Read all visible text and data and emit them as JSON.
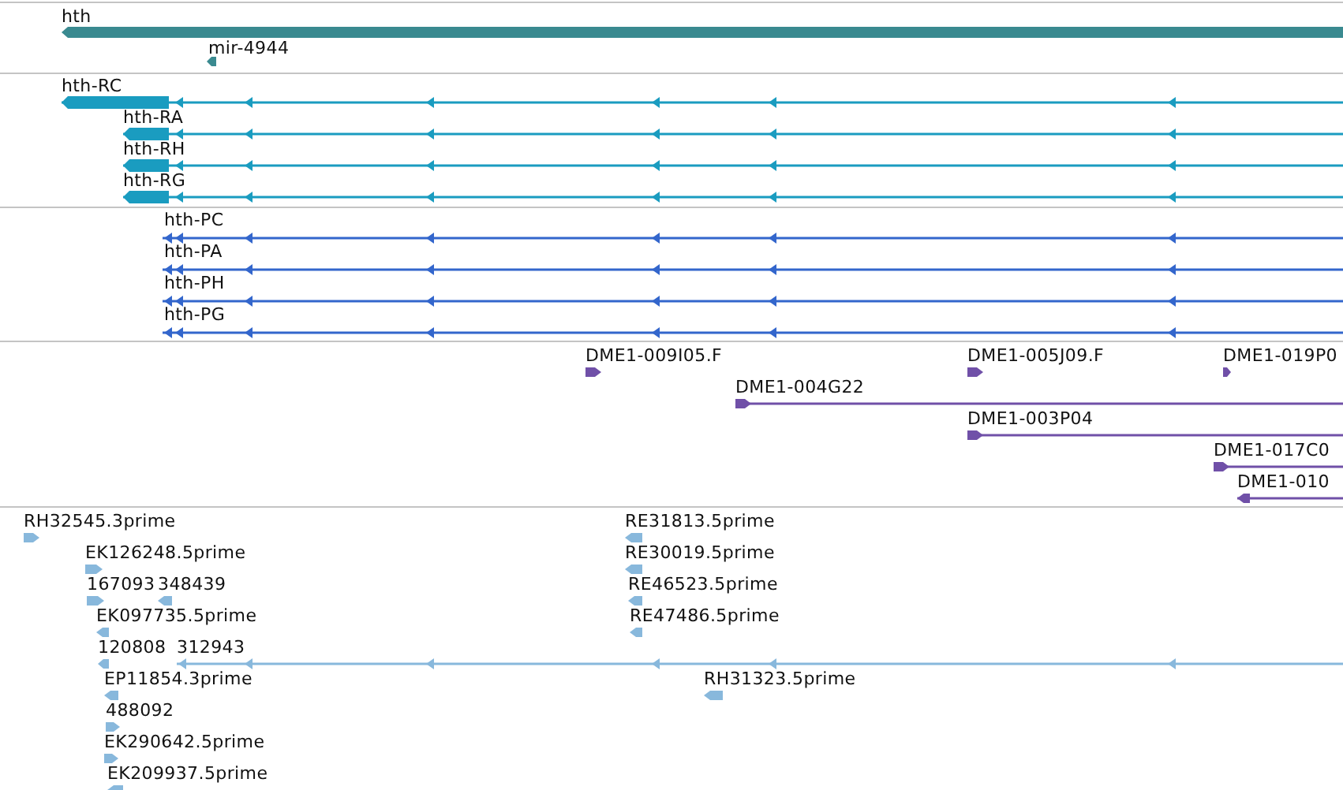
{
  "tracks": [
    {
      "color": "#3a8a90",
      "features": [
        {
          "label": "hth",
          "kind": "block",
          "reverse": true
        },
        {
          "label": "mir-4944",
          "kind": "block",
          "reverse": true
        }
      ]
    },
    {
      "color": "#1a9cc0",
      "features": [
        {
          "label": "hth-RC",
          "kind": "spliced",
          "reverse": true
        },
        {
          "label": "hth-RA",
          "kind": "spliced",
          "reverse": true
        },
        {
          "label": "hth-RH",
          "kind": "spliced",
          "reverse": true
        },
        {
          "label": "hth-RG",
          "kind": "spliced",
          "reverse": true
        }
      ]
    },
    {
      "color": "#3366cc",
      "features": [
        {
          "label": "hth-PC",
          "kind": "spliced",
          "reverse": true
        },
        {
          "label": "hth-PA",
          "kind": "spliced",
          "reverse": true
        },
        {
          "label": "hth-PH",
          "kind": "spliced",
          "reverse": true
        },
        {
          "label": "hth-PG",
          "kind": "spliced",
          "reverse": true
        }
      ]
    },
    {
      "color": "#7050a8",
      "features": [
        {
          "label": "DME1-009I05.F",
          "kind": "block",
          "reverse": false
        },
        {
          "label": "DME1-005J09.F",
          "kind": "block",
          "reverse": false
        },
        {
          "label": "DME1-019P0",
          "kind": "block",
          "reverse": false
        },
        {
          "label": "DME1-004G22",
          "kind": "span",
          "reverse": false
        },
        {
          "label": "DME1-003P04",
          "kind": "span",
          "reverse": false
        },
        {
          "label": "DME1-017C0",
          "kind": "span",
          "reverse": false
        },
        {
          "label": "DME1-010",
          "kind": "span",
          "reverse": true
        }
      ]
    },
    {
      "color": "#88b8dc",
      "features": [
        {
          "label": "RH32545.3prime",
          "kind": "block",
          "reverse": false
        },
        {
          "label": "RE31813.5prime",
          "kind": "block",
          "reverse": true
        },
        {
          "label": "EK126248.5prime",
          "kind": "block",
          "reverse": false
        },
        {
          "label": "RE30019.5prime",
          "kind": "block",
          "reverse": true
        },
        {
          "label": "167093",
          "kind": "block",
          "reverse": false
        },
        {
          "label": "348439",
          "kind": "block",
          "reverse": true
        },
        {
          "label": "RE46523.5prime",
          "kind": "block",
          "reverse": true
        },
        {
          "label": "EK097735.5prime",
          "kind": "block",
          "reverse": true
        },
        {
          "label": "RE47486.5prime",
          "kind": "block",
          "reverse": true
        },
        {
          "label": "120808",
          "kind": "block",
          "reverse": true
        },
        {
          "label": "312943",
          "kind": "spliced",
          "reverse": true
        },
        {
          "label": "EP11854.3prime",
          "kind": "block",
          "reverse": true
        },
        {
          "label": "RH31323.5prime",
          "kind": "block",
          "reverse": true
        },
        {
          "label": "488092",
          "kind": "block",
          "reverse": false
        },
        {
          "label": "EK290642.5prime",
          "kind": "block",
          "reverse": false
        },
        {
          "label": "EK209937.5prime",
          "kind": "block",
          "reverse": true
        }
      ]
    }
  ]
}
